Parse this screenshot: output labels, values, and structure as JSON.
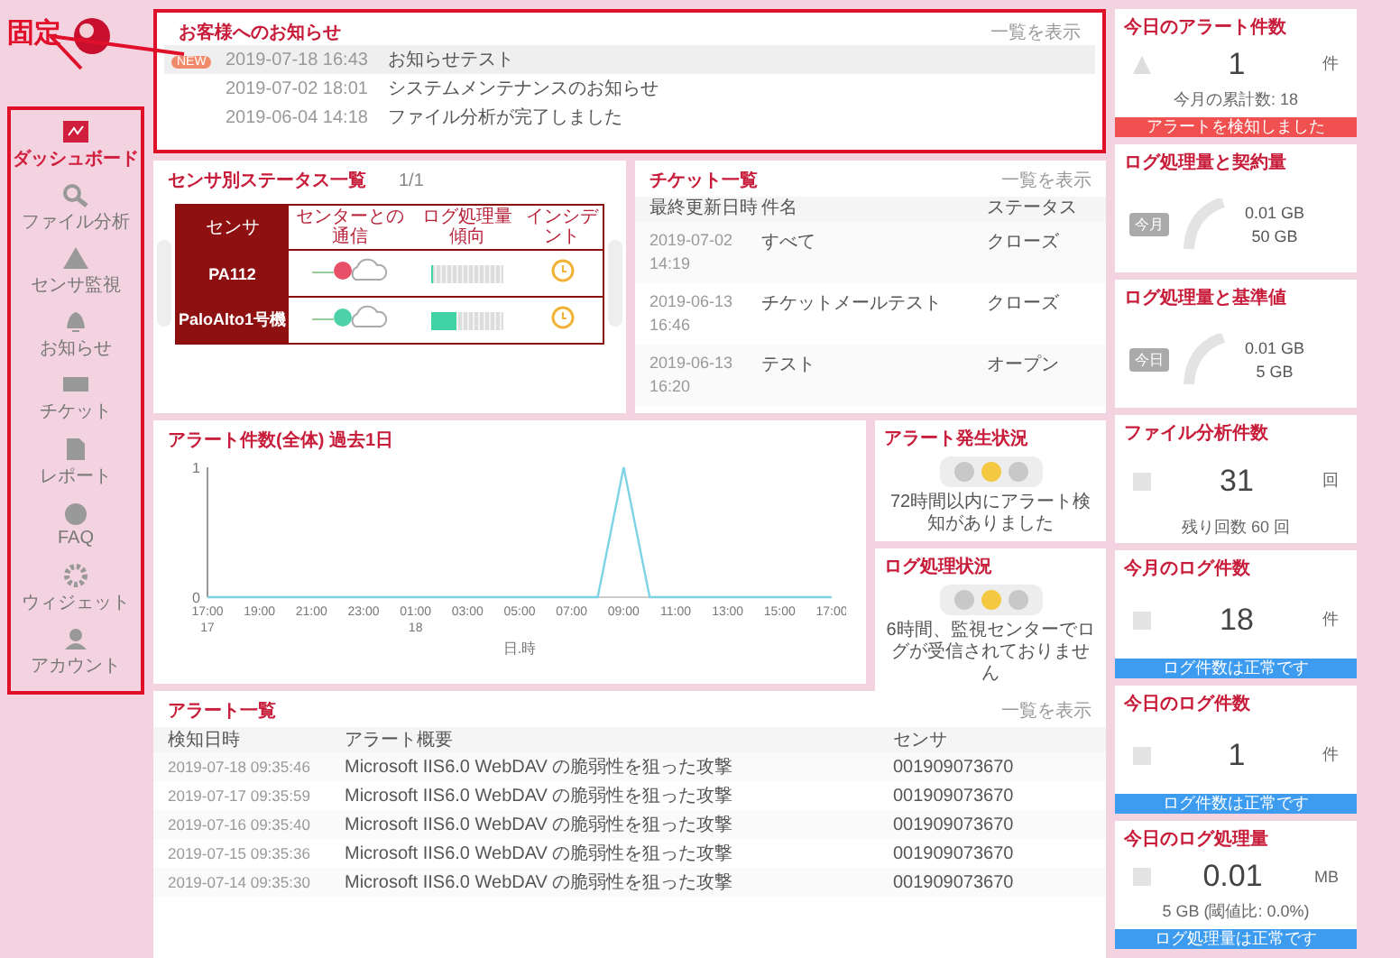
{
  "annotation": {
    "label": "固定"
  },
  "sidebar": {
    "items": [
      {
        "label": "ダッシュボード",
        "selected": true
      },
      {
        "label": "ファイル分析",
        "selected": false
      },
      {
        "label": "センサ監視",
        "selected": false
      },
      {
        "label": "お知らせ",
        "selected": false
      },
      {
        "label": "チケット",
        "selected": false
      },
      {
        "label": "レポート",
        "selected": false
      },
      {
        "label": "FAQ",
        "selected": false
      },
      {
        "label": "ウィジェット",
        "selected": false
      },
      {
        "label": "アカウント",
        "selected": false
      }
    ]
  },
  "notices": {
    "title": "お客様へのお知らせ",
    "link": "一覧を表示",
    "rows": [
      {
        "new": true,
        "badge": "NEW",
        "date": "2019-07-18 16:43",
        "text": "お知らせテスト"
      },
      {
        "new": false,
        "date": "2019-07-02 18:01",
        "text": "システムメンテナンスのお知らせ"
      },
      {
        "new": false,
        "date": "2019-06-04 14:18",
        "text": "ファイル分析が完了しました"
      }
    ]
  },
  "sensors": {
    "title": "センサ別ステータス一覧",
    "page": "1/1",
    "columns": [
      "センサ",
      "センターとの通信",
      "ログ処理量傾向",
      "インシデント"
    ],
    "rows": [
      {
        "name": "PA112",
        "connected": false,
        "level": 0
      },
      {
        "name": "PaloAlto1号機",
        "connected": true,
        "level": 0.35
      }
    ]
  },
  "tickets": {
    "title": "チケット一覧",
    "link": "一覧を表示",
    "columns": [
      "最終更新日時",
      "件名",
      "ステータス"
    ],
    "rows": [
      {
        "date": "2019-07-02",
        "time": "14:19",
        "subject": "すべて",
        "status": "クローズ"
      },
      {
        "date": "2019-06-13",
        "time": "16:46",
        "subject": "チケットメールテスト",
        "status": "クローズ"
      },
      {
        "date": "2019-06-13",
        "time": "16:20",
        "subject": "テスト",
        "status": "オープン"
      }
    ]
  },
  "alert_chart": {
    "title": "アラート件数(全体) 過去1日",
    "chart_data": {
      "type": "line",
      "xlabel": "日.時",
      "categories": [
        "17:00",
        null,
        "19:00",
        null,
        "21:00",
        null,
        "23:00",
        null,
        "01:00",
        null,
        "03:00",
        null,
        "05:00",
        null,
        "07:00",
        null,
        "09:00",
        null,
        "11:00",
        null,
        "13:00",
        null,
        "15:00",
        null,
        "17:00"
      ],
      "series": [
        {
          "color": "#7fd3e6",
          "values": [
            0,
            0,
            0,
            0,
            0,
            0,
            0,
            0,
            0,
            0,
            0,
            0,
            0,
            0,
            0,
            0,
            1,
            0,
            0,
            0,
            0,
            0,
            0,
            0,
            0
          ]
        }
      ],
      "ylim": [
        0,
        1
      ],
      "yticks": [
        0,
        1
      ],
      "annotations": [
        "17",
        "18"
      ]
    }
  },
  "status_cards": [
    {
      "title": "アラート発生状況",
      "lights": [
        {
          "on": false
        },
        {
          "on": true
        },
        {
          "on": false
        }
      ],
      "message": "72時間以内にアラート検知がありました"
    },
    {
      "title": "ログ処理状況",
      "lights": [
        {
          "on": false
        },
        {
          "on": true
        },
        {
          "on": false
        }
      ],
      "message": "6時間、監視センターでログが受信されておりません"
    }
  ],
  "alerts": {
    "title": "アラート一覧",
    "link": "一覧を表示",
    "columns": [
      "検知日時",
      "アラート概要",
      "センサ"
    ],
    "rows": [
      {
        "date": "2019-07-18 09:35:46",
        "summary": "Microsoft IIS6.0 WebDAV の脆弱性を狙った攻撃",
        "sensor": "001909073670"
      },
      {
        "date": "2019-07-17 09:35:59",
        "summary": "Microsoft IIS6.0 WebDAV の脆弱性を狙った攻撃",
        "sensor": "001909073670"
      },
      {
        "date": "2019-07-16 09:35:40",
        "summary": "Microsoft IIS6.0 WebDAV の脆弱性を狙った攻撃",
        "sensor": "001909073670"
      },
      {
        "date": "2019-07-15 09:35:36",
        "summary": "Microsoft IIS6.0 WebDAV の脆弱性を狙った攻撃",
        "sensor": "001909073670"
      },
      {
        "date": "2019-07-14 09:35:30",
        "summary": "Microsoft IIS6.0 WebDAV の脆弱性を狙った攻撃",
        "sensor": "001909073670"
      }
    ]
  },
  "widgets": [
    {
      "kind": "alert",
      "title": "今日のアラート件数",
      "value": "1",
      "unit": "件",
      "note": "今月の累計数: 18",
      "banner": {
        "text": "アラートを検知しました",
        "alert": true
      }
    },
    {
      "kind": "gauge",
      "title": "ログ処理量と契約量",
      "badge": "今月",
      "used": "0.01 GB",
      "limit": "50 GB"
    },
    {
      "kind": "gauge",
      "title": "ログ処理量と基準値",
      "badge": "今日",
      "used": "0.01 GB",
      "limit": "5 GB"
    },
    {
      "kind": "count",
      "title": "ファイル分析件数",
      "value": "31",
      "unit": "回",
      "note": "残り回数 60 回"
    },
    {
      "kind": "count",
      "title": "今月のログ件数",
      "value": "18",
      "unit": "件",
      "banner": {
        "text": "ログ件数は正常です",
        "alert": false
      }
    },
    {
      "kind": "count",
      "title": "今日のログ件数",
      "value": "1",
      "unit": "件",
      "banner": {
        "text": "ログ件数は正常です",
        "alert": false
      }
    },
    {
      "kind": "count",
      "title": "今日のログ処理量",
      "value": "0.01",
      "unit": "MB",
      "note": "5 GB (閾値比: 0.0%)",
      "banner": {
        "text": "ログ処理量は正常です",
        "alert": false
      }
    }
  ]
}
